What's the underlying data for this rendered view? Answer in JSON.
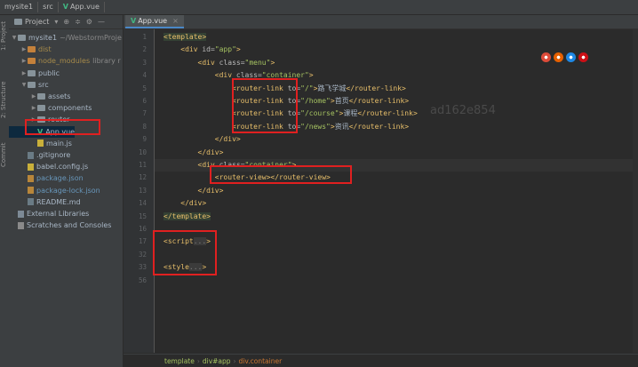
{
  "titlebar": {
    "crumbs": [
      "mysite1",
      "src",
      "App.vue"
    ]
  },
  "left_strip": {
    "labels": [
      "1: Project",
      "2: Structure",
      "Commit"
    ]
  },
  "project_panel": {
    "title": "Project",
    "tree": [
      {
        "label": "mysite1",
        "extra": "~/WebstormProje",
        "type": "folder",
        "depth": 0,
        "open": true
      },
      {
        "label": "dist",
        "type": "folder-orange",
        "depth": 1,
        "open": false
      },
      {
        "label": "node_modules",
        "extra": "library r",
        "type": "folder-orange",
        "depth": 1,
        "open": false
      },
      {
        "label": "public",
        "type": "folder",
        "depth": 1,
        "open": false
      },
      {
        "label": "src",
        "type": "folder",
        "depth": 1,
        "open": true
      },
      {
        "label": "assets",
        "type": "folder",
        "depth": 2,
        "open": false
      },
      {
        "label": "components",
        "type": "folder",
        "depth": 2,
        "open": false
      },
      {
        "label": "router",
        "type": "folder",
        "depth": 2,
        "open": false
      },
      {
        "label": "App.vue",
        "type": "vue",
        "depth": 2
      },
      {
        "label": "main.js",
        "type": "js",
        "depth": 2
      },
      {
        "label": ".gitignore",
        "type": "file",
        "depth": 1
      },
      {
        "label": "babel.config.js",
        "type": "js",
        "depth": 1
      },
      {
        "label": "package.json",
        "type": "json",
        "depth": 1
      },
      {
        "label": "package-lock.json",
        "type": "json",
        "depth": 1
      },
      {
        "label": "README.md",
        "type": "file",
        "depth": 1
      },
      {
        "label": "External Libraries",
        "type": "lib",
        "depth": 0
      },
      {
        "label": "Scratches and Consoles",
        "type": "scratch",
        "depth": 0
      }
    ]
  },
  "editor": {
    "tab": "App.vue",
    "line_numbers": [
      "1",
      "2",
      "3",
      "4",
      "5",
      "6",
      "7",
      "8",
      "9",
      "10",
      "11",
      "12",
      "13",
      "14",
      "15",
      "16",
      "17",
      "32",
      "33",
      "56"
    ],
    "lines": [
      [
        {
          "t": "tag",
          "v": "<template>"
        }
      ],
      [
        {
          "t": "tag",
          "v": "    <div "
        },
        {
          "t": "attr",
          "v": "id="
        },
        {
          "t": "val",
          "v": "\"app\""
        },
        {
          "t": "tag",
          "v": ">"
        }
      ],
      [
        {
          "t": "tag",
          "v": "        <div "
        },
        {
          "t": "attr",
          "v": "class="
        },
        {
          "t": "val",
          "v": "\"menu\""
        },
        {
          "t": "tag",
          "v": ">"
        }
      ],
      [
        {
          "t": "tag",
          "v": "            <div "
        },
        {
          "t": "attr",
          "v": "class="
        },
        {
          "t": "val",
          "v": "\"container\""
        },
        {
          "t": "tag",
          "v": ">"
        }
      ],
      [
        {
          "t": "tag",
          "v": "                <router-link "
        },
        {
          "t": "attr",
          "v": "to="
        },
        {
          "t": "val",
          "v": "\"/\""
        },
        {
          "t": "tag",
          "v": ">"
        },
        {
          "t": "txt",
          "v": "路飞学城"
        },
        {
          "t": "tag",
          "v": "</router-link>"
        }
      ],
      [
        {
          "t": "tag",
          "v": "                <router-link "
        },
        {
          "t": "attr",
          "v": "to="
        },
        {
          "t": "val",
          "v": "\"/home\""
        },
        {
          "t": "tag",
          "v": ">"
        },
        {
          "t": "txt",
          "v": "首页"
        },
        {
          "t": "tag",
          "v": "</router-link>"
        }
      ],
      [
        {
          "t": "tag",
          "v": "                <router-link "
        },
        {
          "t": "attr",
          "v": "to="
        },
        {
          "t": "val",
          "v": "\"/course\""
        },
        {
          "t": "tag",
          "v": ">"
        },
        {
          "t": "txt",
          "v": "课程"
        },
        {
          "t": "tag",
          "v": "</router-link>"
        }
      ],
      [
        {
          "t": "tag",
          "v": "                <router-link "
        },
        {
          "t": "attr",
          "v": "to="
        },
        {
          "t": "val",
          "v": "\"/news\""
        },
        {
          "t": "tag",
          "v": ">"
        },
        {
          "t": "txt",
          "v": "资讯"
        },
        {
          "t": "tag",
          "v": "</router-link>"
        }
      ],
      [
        {
          "t": "tag",
          "v": "            </div>"
        }
      ],
      [
        {
          "t": "tag",
          "v": "        </div>"
        }
      ],
      [
        {
          "t": "tag",
          "v": "        <div "
        },
        {
          "t": "attr",
          "v": "class="
        },
        {
          "t": "val",
          "v": "\"container\""
        },
        {
          "t": "tag",
          "v": ">"
        }
      ],
      [
        {
          "t": "tag",
          "v": "            <router-view></router-view>"
        }
      ],
      [
        {
          "t": "tag",
          "v": "        </div>"
        }
      ],
      [
        {
          "t": "tag",
          "v": "    </div>"
        }
      ],
      [
        {
          "t": "tag",
          "v": "</template>"
        }
      ],
      [],
      [
        {
          "t": "tag",
          "v": "<script"
        },
        {
          "t": "fold",
          "v": "..."
        },
        {
          "t": "tag",
          "v": ">"
        }
      ],
      [],
      [
        {
          "t": "tag",
          "v": "<style"
        },
        {
          "t": "fold",
          "v": "..."
        },
        {
          "t": "tag",
          "v": ">"
        }
      ],
      []
    ]
  },
  "watermark": "ad162e854",
  "browser_icons": [
    "chrome-icon",
    "firefox-icon",
    "safari-icon",
    "opera-icon"
  ],
  "browser_colors": [
    "#dd4b39",
    "#e66000",
    "#1e88e5",
    "#cc0f16"
  ],
  "statusbar": {
    "breadcrumb": [
      "template",
      "div#app",
      "div.container"
    ]
  }
}
